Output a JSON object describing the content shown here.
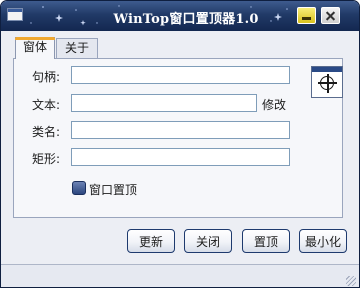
{
  "window": {
    "title": "WinTop窗口置顶器1.0"
  },
  "tabs": [
    {
      "label": "窗体"
    },
    {
      "label": "关于"
    }
  ],
  "form": {
    "handle_label": "句柄:",
    "handle_value": "",
    "text_label": "文本:",
    "text_value": "",
    "modify_label": "修改",
    "class_label": "类名:",
    "class_value": "",
    "rect_label": "矩形:",
    "rect_value": "",
    "topmost_label": "窗口置顶"
  },
  "buttons": {
    "refresh": "更新",
    "close": "关闭",
    "set_top": "置顶",
    "minimize": "最小化"
  },
  "colors": {
    "titlebar": "#213a67",
    "accent": "#f0a830",
    "button_border": "#1e3a6e"
  }
}
